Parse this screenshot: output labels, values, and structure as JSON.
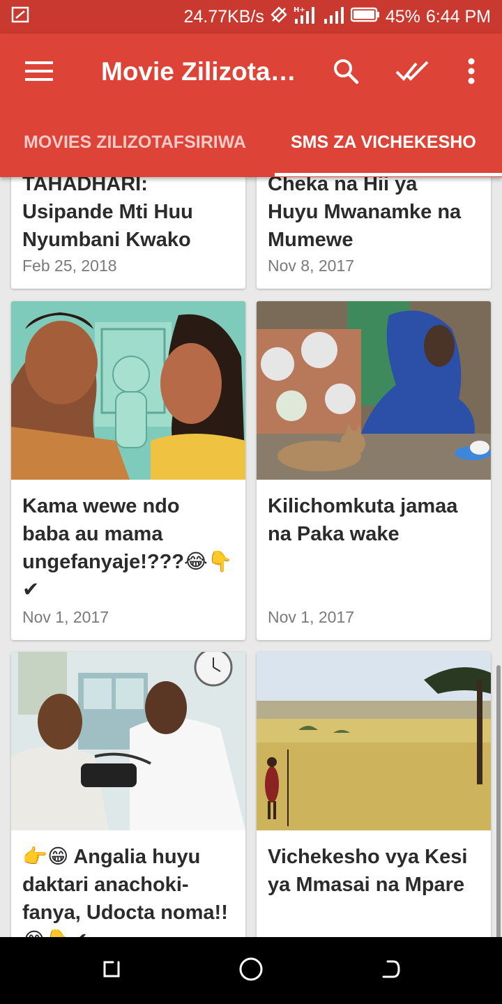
{
  "status_bar": {
    "speed": "24.77KB/s",
    "network": "H+",
    "battery": "45%",
    "time": "6:44 PM"
  },
  "toolbar": {
    "title": "Movie Zilizota…",
    "icons": [
      "menu-icon",
      "search-icon",
      "double-check-icon",
      "more-vert-icon"
    ]
  },
  "tabs": [
    {
      "label": "MOVIES ZILIZOTAFSIRIWA",
      "selected": false
    },
    {
      "label": "SMS ZA VICHEKESHO",
      "selected": true
    }
  ],
  "cards": [
    {
      "title_lines": [
        "TAHADHARI:",
        "Usipande Mti Huu",
        "Nyumbani Kwako"
      ],
      "date": "Feb 25, 2018"
    },
    {
      "title_lines": [
        "Cheka na Hii ya",
        "Huyu Mwanamke na",
        "Mumewe"
      ],
      "date": "Nov 8, 2017"
    },
    {
      "title_lines": [
        "Kama wewe ndo",
        "baba au mama",
        "ungefanyaje!???😂👇",
        "✔"
      ],
      "date": "Nov 1, 2017",
      "image": "illustrated couple with child"
    },
    {
      "title_lines": [
        "Kilichomkuta jamaa",
        "na Paka wake"
      ],
      "date": "Nov 1, 2017",
      "image": "woman in blue headscarf with cat"
    },
    {
      "title_lines": [
        "👉😁 Angalia huyu",
        "daktari anachoki-",
        "fanya, Udocta noma!!",
        "😂👇✔"
      ],
      "date": "",
      "image": "doctor checking blood pressure"
    },
    {
      "title_lines": [
        "Vichekesho vya Kesi",
        "ya Mmasai na Mpare"
      ],
      "date": "",
      "image": "maasai man in savanna"
    }
  ],
  "nav": {
    "icons": [
      "recents-icon",
      "home-icon",
      "back-icon"
    ]
  },
  "colors": {
    "primary": "#dd4337",
    "status": "#c9392f",
    "background": "#e9e9e9"
  }
}
